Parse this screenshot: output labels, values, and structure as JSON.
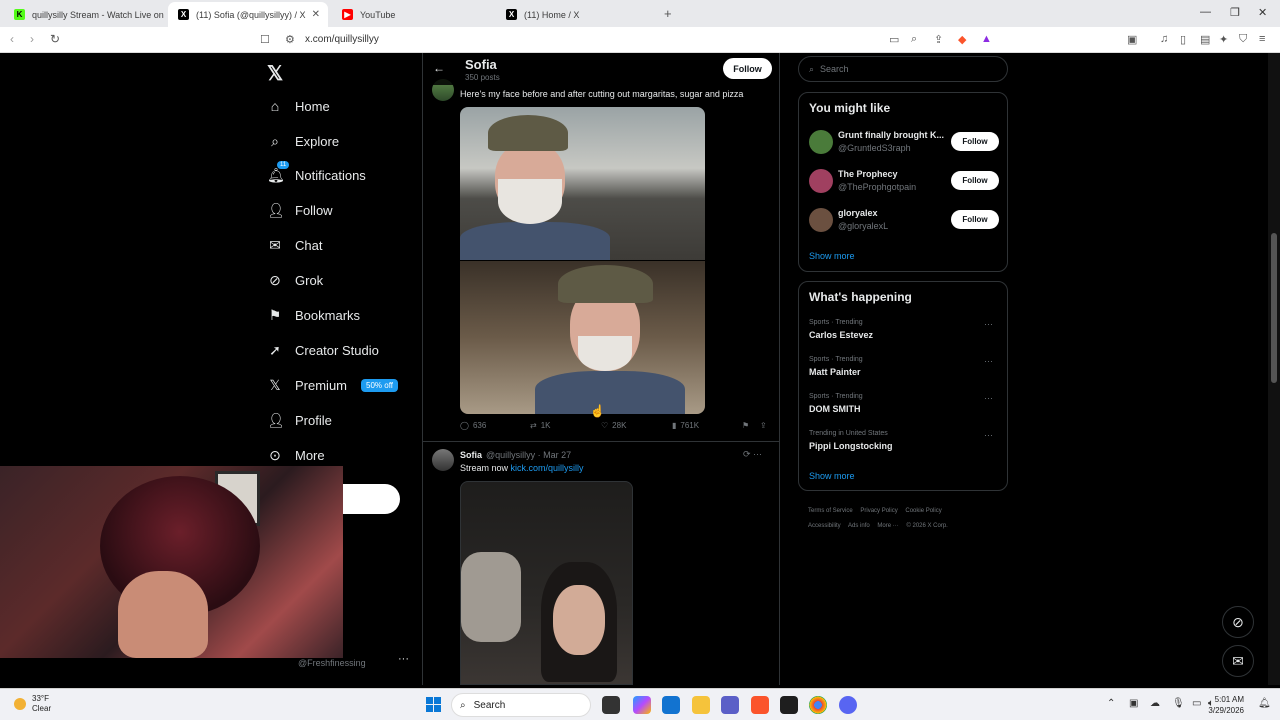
{
  "browser": {
    "tabs": [
      {
        "title": "quillysilly Stream - Watch Live on",
        "favicon": "kick-favicon",
        "color": "#53fc18"
      },
      {
        "title": "(11) Sofia (@quillysillyy) / X",
        "favicon": "x-favicon",
        "color": "#000000",
        "active": true
      },
      {
        "title": "YouTube",
        "favicon": "youtube-favicon",
        "color": "#ff0000"
      },
      {
        "title": "(11) Home / X",
        "favicon": "x-favicon",
        "color": "#000000"
      }
    ],
    "url": "x.com/quillysillyy"
  },
  "nav": {
    "items": [
      {
        "label": "Home",
        "icon": "home-icon"
      },
      {
        "label": "Explore",
        "icon": "search-icon"
      },
      {
        "label": "Notifications",
        "icon": "bell-icon",
        "badge": "11"
      },
      {
        "label": "Follow",
        "icon": "person-plus-icon"
      },
      {
        "label": "Chat",
        "icon": "mail-icon"
      },
      {
        "label": "Grok",
        "icon": "grok-icon"
      },
      {
        "label": "Bookmarks",
        "icon": "bookmark-icon"
      },
      {
        "label": "Creator Studio",
        "icon": "rocket-icon"
      },
      {
        "label": "Premium",
        "icon": "x-icon",
        "pill": "50% off"
      },
      {
        "label": "Profile",
        "icon": "person-icon"
      },
      {
        "label": "More",
        "icon": "more-circle-icon"
      }
    ],
    "account_handle": "@Freshfinessing"
  },
  "profile": {
    "name": "Sofia",
    "posts": "350 posts",
    "follow_label": "Follow"
  },
  "post1": {
    "text": "Here's my face before and after cutting out margaritas, sugar and pizza",
    "replies": "636",
    "reposts": "1K",
    "likes": "28K",
    "views": "761K"
  },
  "post2": {
    "name": "Sofia",
    "handle": "@quillysillyy · Mar 27",
    "text_prefix": "Stream now ",
    "link": "kick.com/quillysilly"
  },
  "search": {
    "placeholder": "Search"
  },
  "you_might_like": {
    "title": "You might like",
    "items": [
      {
        "name": "Grunt finally brought K...",
        "handle": "@GruntledS3raph",
        "follow": "Follow",
        "color": "#4a7b3a"
      },
      {
        "name": "The Prophecy",
        "handle": "@TheProphgotpain",
        "follow": "Follow",
        "color": "#a04060"
      },
      {
        "name": "gloryalex",
        "handle": "@gloryalexL",
        "follow": "Follow",
        "color": "#6b5040"
      }
    ],
    "show_more": "Show more"
  },
  "whats_happening": {
    "title": "What's happening",
    "items": [
      {
        "context": "Sports · Trending",
        "topic": "Carlos Estevez"
      },
      {
        "context": "Sports · Trending",
        "topic": "Matt Painter"
      },
      {
        "context": "Sports · Trending",
        "topic": "DOM SMITH"
      },
      {
        "context": "Trending in United States",
        "topic": "Pippi Longstocking"
      }
    ],
    "show_more": "Show more"
  },
  "footer": {
    "links": [
      "Terms of Service",
      "Privacy Policy",
      "Cookie Policy",
      "Accessibility",
      "Ads info",
      "More ···",
      "© 2026 X Corp."
    ]
  },
  "taskbar": {
    "temp": "33°F",
    "condition": "Clear",
    "search_label": "Search",
    "time": "5:01 AM",
    "date": "3/29/2026"
  },
  "colors": {
    "accent": "#1d9bf0",
    "bg": "#000000",
    "border": "#2f3336"
  }
}
